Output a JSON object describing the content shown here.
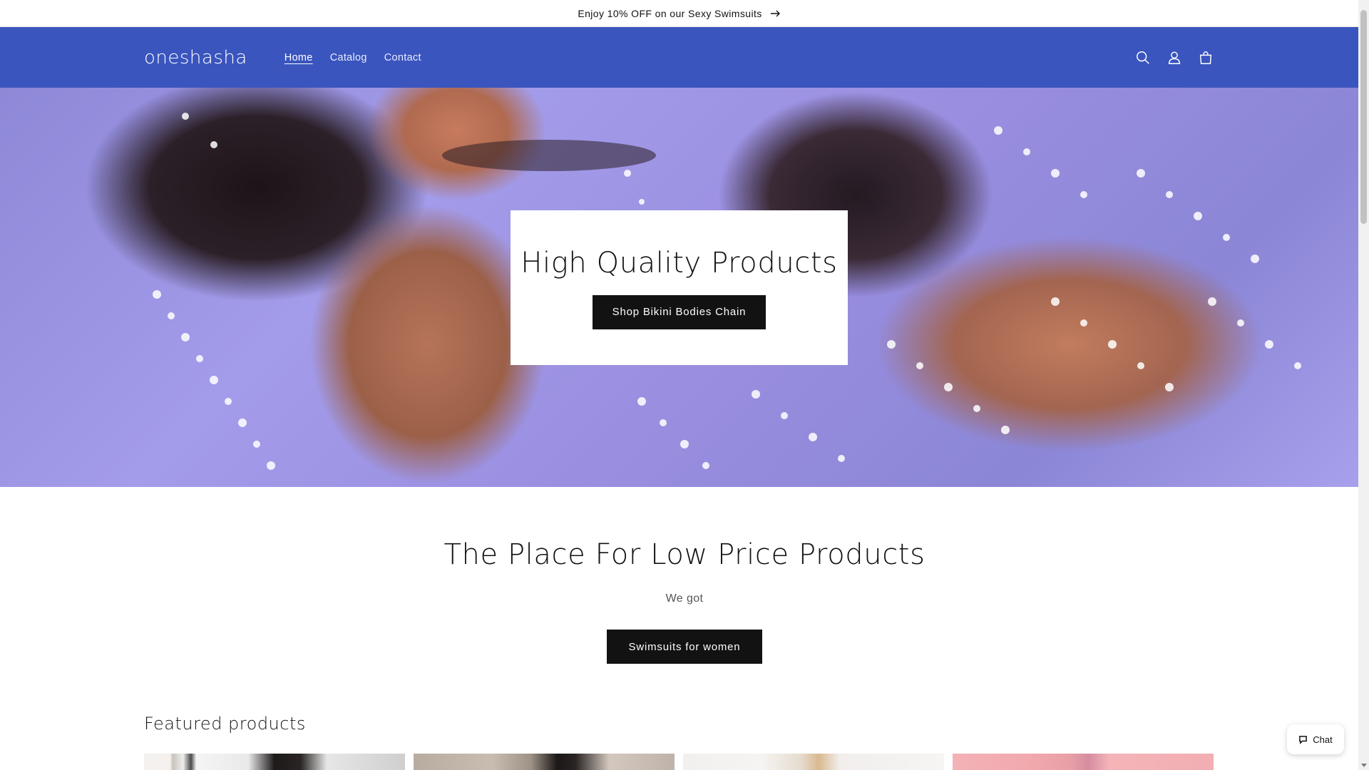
{
  "announcement": {
    "text": "Enjoy 10% OFF on our Sexy Swimsuits"
  },
  "header": {
    "logo": "oneshasha",
    "nav": [
      {
        "label": "Home",
        "active": true
      },
      {
        "label": "Catalog",
        "active": false
      },
      {
        "label": "Contact",
        "active": false
      }
    ],
    "icons": [
      "search-icon",
      "account-icon",
      "cart-icon"
    ]
  },
  "hero": {
    "title": "High Quality Products",
    "button_label": "Shop Bikini Bodies Chain"
  },
  "rich_text": {
    "title": "The Place For Low Price Products",
    "text": "We got",
    "button_label": "Swimsuits for women"
  },
  "featured": {
    "title": "Featured products"
  },
  "chat": {
    "label": "Chat"
  },
  "colors": {
    "header_bg": "#3a55be",
    "button_bg": "#121212",
    "text": "#121212"
  }
}
